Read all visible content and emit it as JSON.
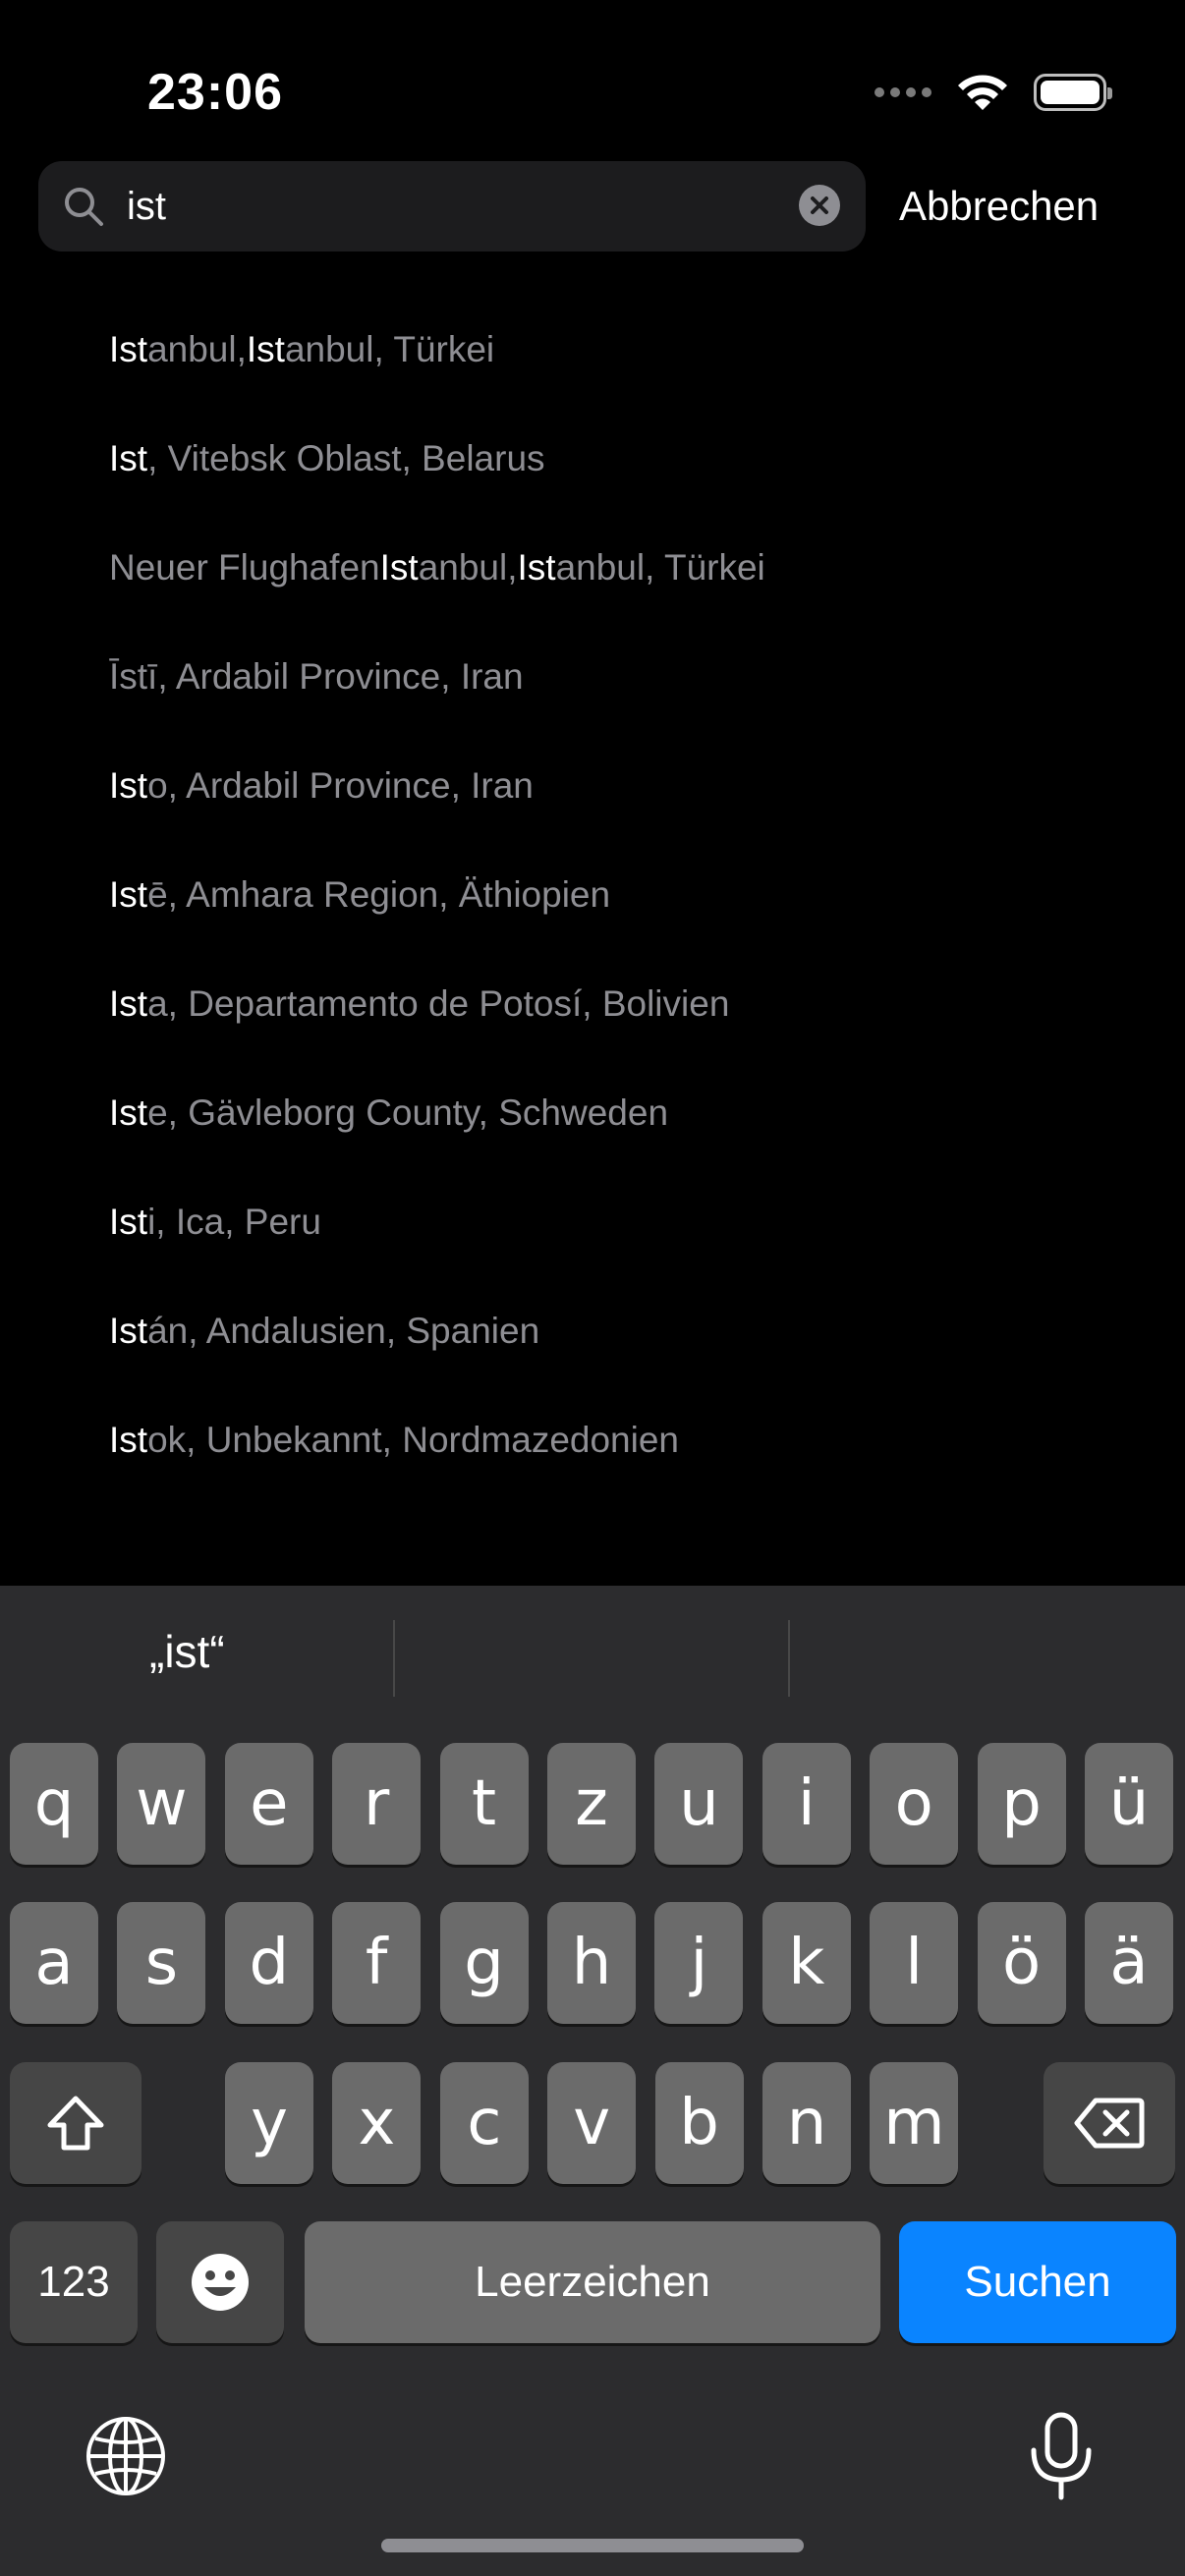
{
  "status": {
    "time": "23:06"
  },
  "search": {
    "query": "ist",
    "cancel_label": "Abbrechen"
  },
  "results": [
    {
      "parts": [
        {
          "t": "Ist",
          "hl": true
        },
        {
          "t": "anbul, ",
          "hl": false
        },
        {
          "t": "Ist",
          "hl": true
        },
        {
          "t": "anbul, Türkei",
          "hl": false
        }
      ]
    },
    {
      "parts": [
        {
          "t": "Ist",
          "hl": true
        },
        {
          "t": ", Vitebsk Oblast, Belarus",
          "hl": false
        }
      ]
    },
    {
      "parts": [
        {
          "t": "Neuer Flughafen ",
          "hl": false
        },
        {
          "t": "Ist",
          "hl": true
        },
        {
          "t": "anbul, ",
          "hl": false
        },
        {
          "t": "Ist",
          "hl": true
        },
        {
          "t": "anbul, Türkei",
          "hl": false
        }
      ]
    },
    {
      "parts": [
        {
          "t": "Īstī, Ardabil Province, Iran",
          "hl": false
        }
      ]
    },
    {
      "parts": [
        {
          "t": "Ist",
          "hl": true
        },
        {
          "t": "o, Ardabil Province, Iran",
          "hl": false
        }
      ]
    },
    {
      "parts": [
        {
          "t": "Ist",
          "hl": true
        },
        {
          "t": "ē, Amhara Region, Äthiopien",
          "hl": false
        }
      ]
    },
    {
      "parts": [
        {
          "t": "Ist",
          "hl": true
        },
        {
          "t": "a, Departamento de Potosí, Bolivien",
          "hl": false
        }
      ]
    },
    {
      "parts": [
        {
          "t": "Ist",
          "hl": true
        },
        {
          "t": "e, Gävleborg County, Schweden",
          "hl": false
        }
      ]
    },
    {
      "parts": [
        {
          "t": "Ist",
          "hl": true
        },
        {
          "t": "i, Ica, Peru",
          "hl": false
        }
      ]
    },
    {
      "parts": [
        {
          "t": "Ist",
          "hl": true
        },
        {
          "t": "án, Andalusien, Spanien",
          "hl": false
        }
      ]
    },
    {
      "parts": [
        {
          "t": "Ist",
          "hl": true
        },
        {
          "t": "ok, Unbekannt, Nordmazedonien",
          "hl": false
        }
      ]
    }
  ],
  "keyboard": {
    "suggestion": "„ist“",
    "row1": [
      "q",
      "w",
      "e",
      "r",
      "t",
      "z",
      "u",
      "i",
      "o",
      "p",
      "ü"
    ],
    "row2": [
      "a",
      "s",
      "d",
      "f",
      "g",
      "h",
      "j",
      "k",
      "l",
      "ö",
      "ä"
    ],
    "row3": [
      "y",
      "x",
      "c",
      "v",
      "b",
      "n",
      "m"
    ],
    "numbers_label": "123",
    "space_label": "Leerzeichen",
    "return_label": "Suchen"
  },
  "colors": {
    "accent": "#0a84ff",
    "dimmed_text": "#8e8e93"
  }
}
